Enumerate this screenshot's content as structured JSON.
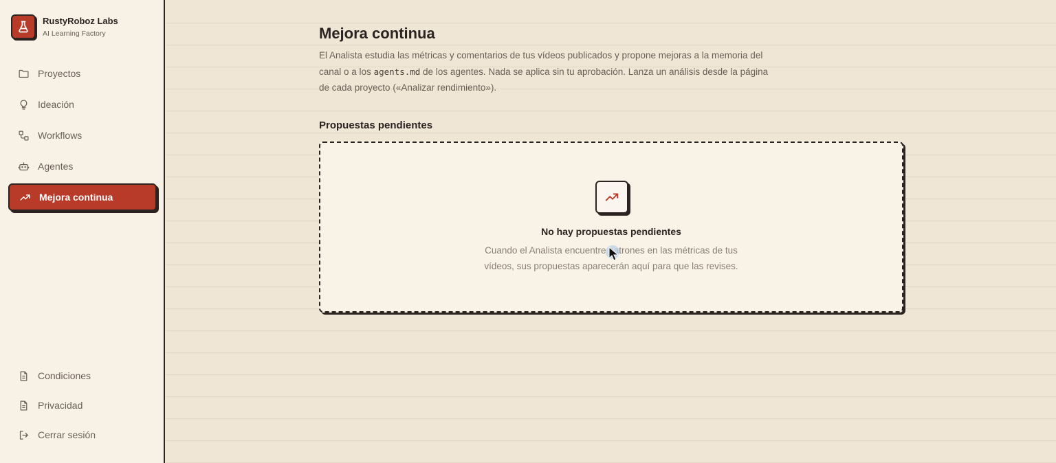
{
  "brand": {
    "name": "RustyRoboz Labs",
    "subtitle": "AI Learning Factory"
  },
  "nav": {
    "items": [
      {
        "label": "Proyectos",
        "icon": "folder-icon"
      },
      {
        "label": "Ideación",
        "icon": "lightbulb-icon"
      },
      {
        "label": "Workflows",
        "icon": "workflow-icon"
      },
      {
        "label": "Agentes",
        "icon": "robot-icon"
      },
      {
        "label": "Mejora continua",
        "icon": "trending-up-icon",
        "active": true
      }
    ],
    "bottom": [
      {
        "label": "Condiciones",
        "icon": "document-icon"
      },
      {
        "label": "Privacidad",
        "icon": "document-icon"
      },
      {
        "label": "Cerrar sesión",
        "icon": "logout-icon"
      }
    ]
  },
  "main": {
    "title": "Mejora continua",
    "description": {
      "part1": "El Analista estudia las métricas y comentarios de tus vídeos publicados y propone mejoras a la memoria del canal o a los ",
      "code": "agents.md",
      "part2": " de los agentes. Nada se aplica sin tu aprobación. Lanza un análisis desde la página de cada proyecto («Analizar rendimiento»)."
    },
    "section_title": "Propuestas pendientes",
    "empty_state": {
      "icon": "trending-up-icon",
      "title": "No hay propuestas pendientes",
      "description": "Cuando el Analista encuentre patrones en las métricas de tus vídeos, sus propuestas aparecerán aquí para que las revises."
    }
  },
  "colors": {
    "accent": "#b83a28",
    "background": "#efe6d6",
    "sidebar": "#f8f1e6",
    "ink": "#2b2320"
  }
}
